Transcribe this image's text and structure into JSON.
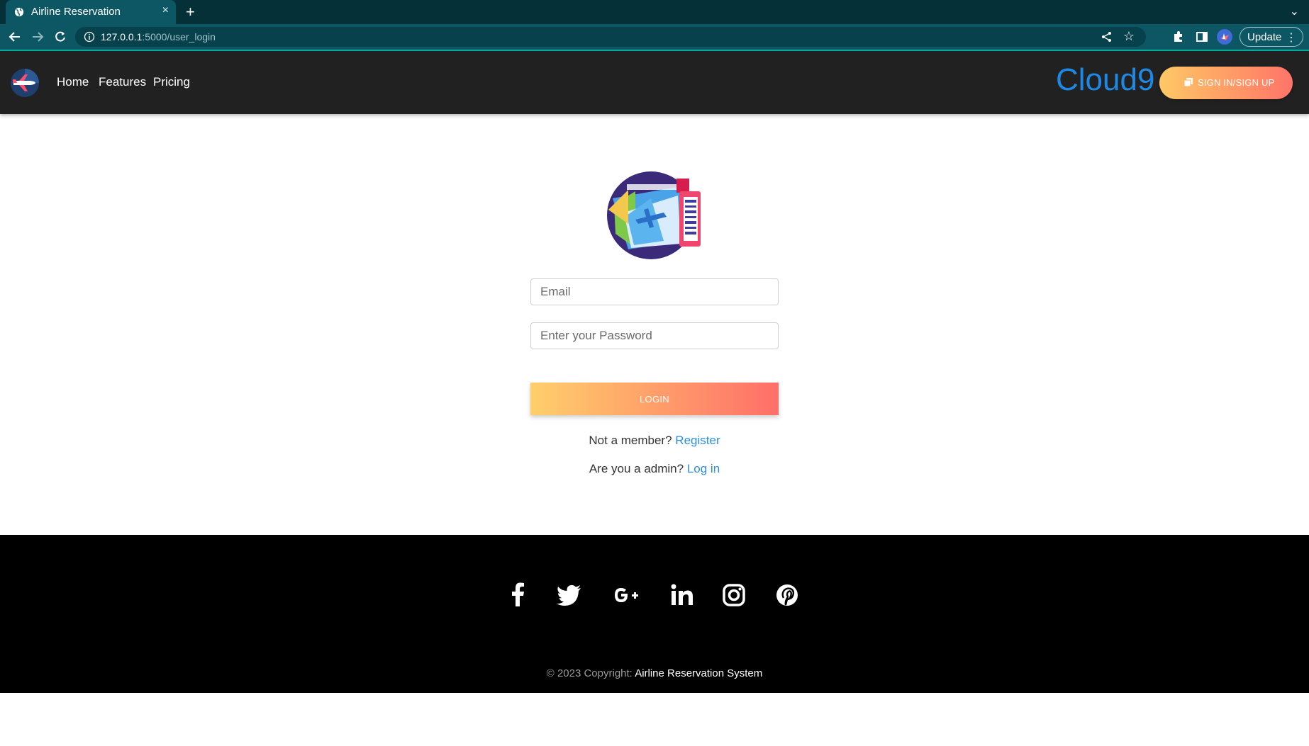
{
  "browser": {
    "tab_title": "Airline Reservation",
    "tab_close": "×",
    "new_tab": "+",
    "url_host": "127.0.0.1",
    "url_rest": ":5000/user_login",
    "update_label": "Update",
    "update_menu": "⋮",
    "star": "☆",
    "tab_menu": "⌄"
  },
  "navbar": {
    "links": [
      "Home",
      "Features",
      "Pricing"
    ],
    "brand": "Cloud9",
    "signin_label": "SIGN IN/SIGN UP"
  },
  "login": {
    "email_placeholder": "Email",
    "password_placeholder": "Enter your Password",
    "login_label": "LOGIN",
    "member_text": "Not a member?",
    "register_link": "Register",
    "admin_text": "Are you a admin?",
    "admin_link": "Log in"
  },
  "footer": {
    "social_icons": [
      "facebook-icon",
      "twitter-icon",
      "google-plus-icon",
      "linkedin-icon",
      "instagram-icon",
      "pinterest-icon"
    ],
    "copyright_prefix": "© 2023 Copyright:",
    "copyright_owner": "Airline Reservation System"
  },
  "colors": {
    "navbar_bg": "#212121",
    "brand": "#1e88e5",
    "button_gradient_start": "#ffcf6b",
    "button_gradient_end": "#ff6f69",
    "link": "#2d8ee3",
    "footer_bg": "#000000"
  }
}
